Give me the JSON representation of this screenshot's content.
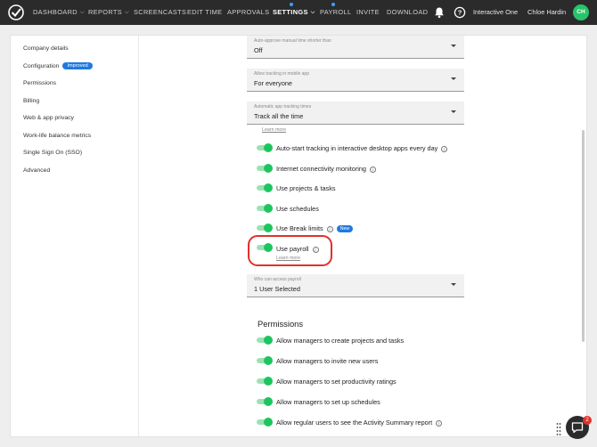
{
  "nav": {
    "items": [
      {
        "label": "DASHBOARD",
        "caret": true
      },
      {
        "label": "REPORTS",
        "caret": true
      },
      {
        "label": "SCREENCASTS"
      },
      {
        "label": "EDIT TIME"
      },
      {
        "label": "APPROVALS"
      },
      {
        "label": "SETTINGS",
        "caret": true,
        "active": true
      },
      {
        "label": "PAYROLL"
      },
      {
        "label": "INVITE"
      },
      {
        "label": "DOWNLOAD"
      }
    ],
    "company": "Interactive One",
    "user": "Chloe Hardin",
    "avatar_initials": "CH",
    "icons": [
      "bell-icon",
      "help-icon"
    ],
    "accent_dot_color": "#3ba0ff"
  },
  "sidebar": {
    "items": [
      {
        "label": "Company details"
      },
      {
        "label": "Configuration",
        "badge": "Improved"
      },
      {
        "label": "Permissions"
      },
      {
        "label": "Billing"
      },
      {
        "label": "Web & app privacy"
      },
      {
        "label": "Work-life balance metrics"
      },
      {
        "label": "Single Sign On (SSO)"
      },
      {
        "label": "Advanced"
      }
    ]
  },
  "settings": {
    "auto_approve": {
      "label": "Auto-approve manual time shorter than",
      "value": "Off"
    },
    "mobile_tracking": {
      "label": "Allow tracking in mobile app",
      "value": "For everyone"
    },
    "app_tracking": {
      "label": "Automatic app tracking times",
      "value": "Track all the time"
    },
    "learn_more": "Learn more",
    "toggles": [
      {
        "label": "Auto-start tracking in interactive desktop apps every day",
        "on": true,
        "info": true
      },
      {
        "label": "Internet connectivity monitoring",
        "on": true,
        "info": true
      },
      {
        "label": "Use projects & tasks",
        "on": true
      },
      {
        "label": "Use schedules",
        "on": true
      },
      {
        "label": "Use Break limits",
        "on": true,
        "info": true,
        "badge": "New"
      },
      {
        "label": "Use payroll",
        "on": true,
        "info": true
      }
    ],
    "payroll_learn_more": "Learn more",
    "payroll_access": {
      "label": "Who can access payroll",
      "value": "1 User Selected"
    }
  },
  "permissions": {
    "title": "Permissions",
    "toggles": [
      {
        "label": "Allow managers to create projects and tasks",
        "on": true
      },
      {
        "label": "Allow managers to invite new users",
        "on": true
      },
      {
        "label": "Allow managers to set productivity ratings",
        "on": true
      },
      {
        "label": "Allow managers to set up schedules",
        "on": true
      },
      {
        "label": "Allow regular users to see the Activity Summary report",
        "on": true,
        "info": true
      }
    ]
  },
  "chat": {
    "unread": "2"
  },
  "colors": {
    "toggle_on": "#1ec55f",
    "highlight": "#e0312b",
    "badge": "#1f7ae0"
  }
}
